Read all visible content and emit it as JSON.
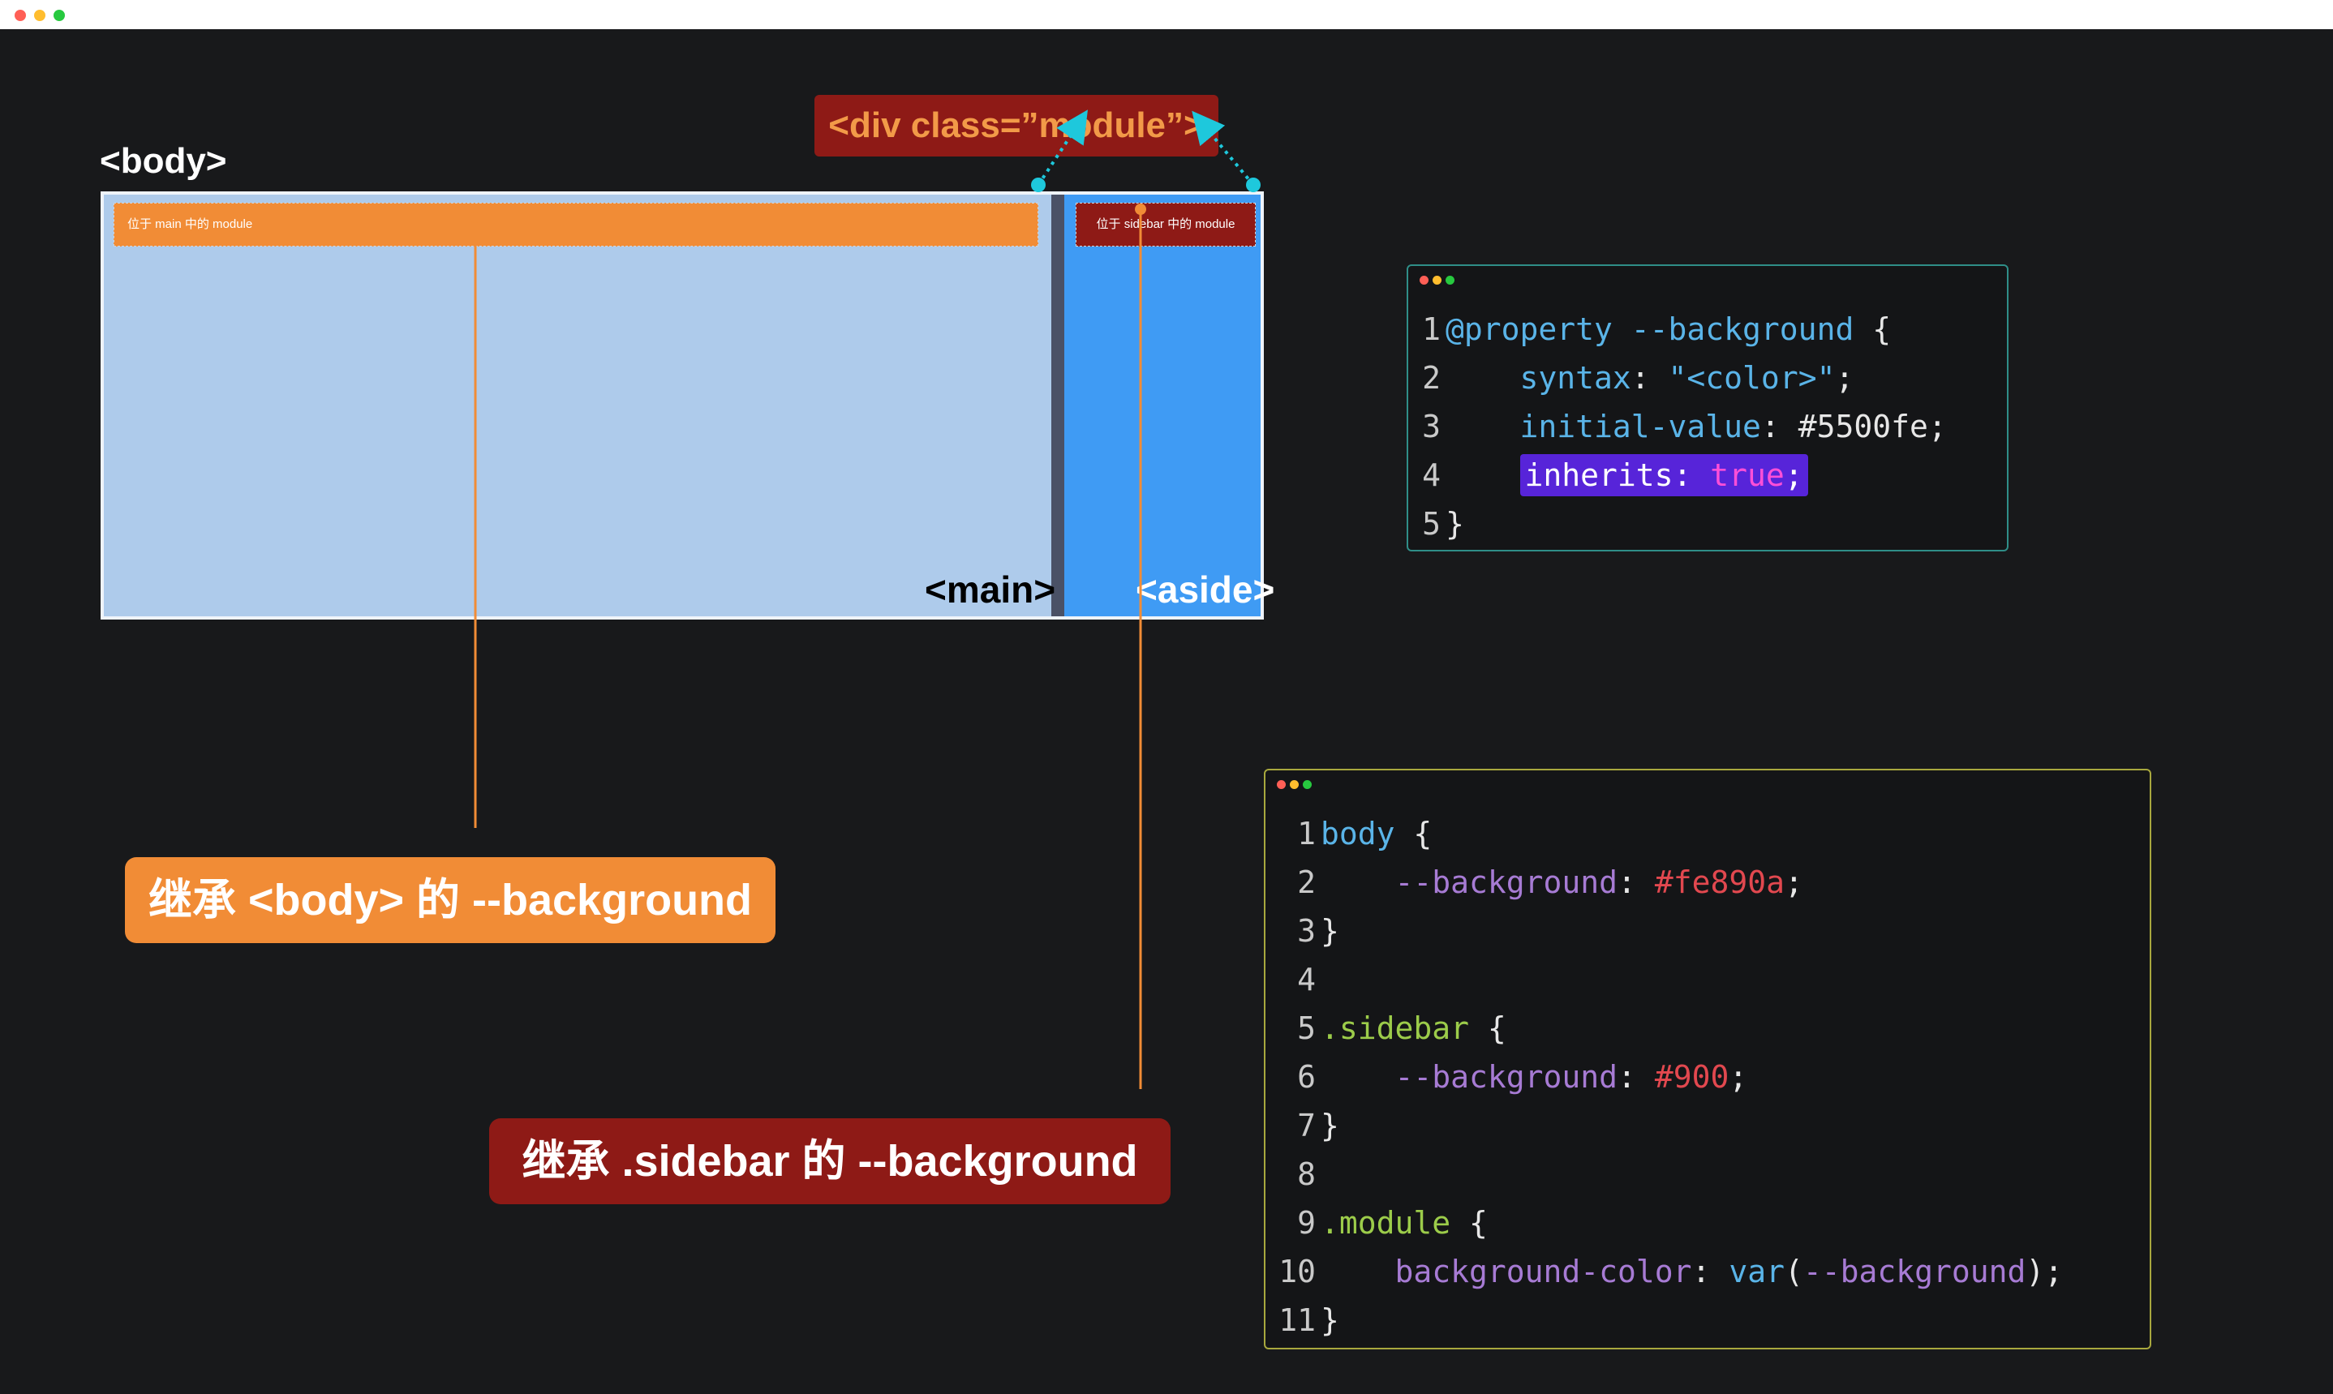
{
  "window": {
    "dots": [
      "#ff5f56",
      "#ffbd2e",
      "#27c93f"
    ]
  },
  "diagram": {
    "body_label": "<body>",
    "main_label": "<main>",
    "aside_label": "<aside>",
    "module_main_text": "位于 main 中的 module",
    "module_sidebar_text": "位于 sidebar 中的 module",
    "div_badge": "<div class=”module”>",
    "callout_body": "继承 <body> 的 --background",
    "callout_sidebar": "继承 .sidebar 的 --background",
    "colors": {
      "body_bg": "#aecbeb",
      "aside_bg": "#3f9bf4",
      "orange": "#f18c36",
      "dark_red": "#8e1a16",
      "connector": "#1ec8dc"
    }
  },
  "code_panel_1": {
    "lines": [
      {
        "n": "1",
        "parts": [
          "@property",
          " --background",
          " {"
        ]
      },
      {
        "n": "2",
        "parts": [
          "    syntax",
          ": ",
          "\"<color>\"",
          ";"
        ]
      },
      {
        "n": "3",
        "parts": [
          "    initial-value",
          ": ",
          "#5500fe",
          ";"
        ]
      },
      {
        "n": "4",
        "parts": [
          "    ",
          "inherits:",
          " true",
          ";"
        ]
      },
      {
        "n": "5",
        "parts": [
          "}"
        ]
      }
    ]
  },
  "code_panel_2": {
    "lines": [
      {
        "n": "1",
        "parts": [
          "body",
          " {"
        ]
      },
      {
        "n": "2",
        "parts": [
          "    --background",
          ": ",
          "#fe890a",
          ";"
        ]
      },
      {
        "n": "3",
        "parts": [
          "}"
        ]
      },
      {
        "n": "4",
        "parts": [
          ""
        ]
      },
      {
        "n": "5",
        "parts": [
          ".sidebar",
          " {"
        ]
      },
      {
        "n": "6",
        "parts": [
          "    --background",
          ": ",
          "#900",
          ";"
        ]
      },
      {
        "n": "7",
        "parts": [
          "}"
        ]
      },
      {
        "n": "8",
        "parts": [
          ""
        ]
      },
      {
        "n": "9",
        "parts": [
          ".module",
          " {"
        ]
      },
      {
        "n": "10",
        "parts": [
          "    background-color",
          ": ",
          "var",
          "(",
          "--background",
          ");"
        ]
      },
      {
        "n": "11",
        "parts": [
          "}"
        ]
      }
    ]
  }
}
